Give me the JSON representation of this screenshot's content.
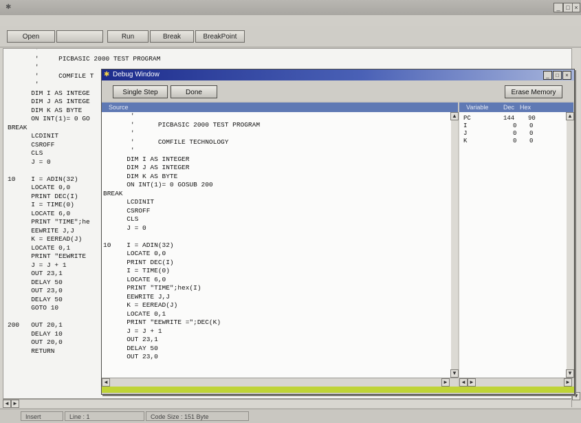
{
  "window": {
    "title": "",
    "minimize": "_",
    "maximize": "□",
    "close": "×"
  },
  "toolbar": {
    "open": "Open",
    "blank": "",
    "run": "Run",
    "break": "Break",
    "breakpoint": "BreakPoint"
  },
  "editor": {
    "code": "       '\n       '     PICBASIC 2000 TEST PROGRAM\n       '\n       '     COMFILE T\n       '\n      DIM I AS INTEGE\n      DIM J AS INTEGE\n      DIM K AS BYTE\n      ON INT(1)= 0 GO\nBREAK\n      LCDINIT\n      CSROFF\n      CLS\n      J = 0\n\n10    I = ADIN(32)\n      LOCATE 0,0\n      PRINT DEC(I)\n      I = TIME(0)\n      LOCATE 6,0\n      PRINT \"TIME\";he\n      EEWRITE J,J\n      K = EEREAD(J)\n      LOCATE 0,1\n      PRINT \"EEWRITE\n      J = J + 1\n      OUT 23,1\n      DELAY 50\n      OUT 23,0\n      DELAY 50\n      GOTO 10\n\n200   OUT 20,1\n      DELAY 10\n      OUT 20,0\n      RETURN"
  },
  "debug": {
    "title": "Debug Window",
    "buttons": {
      "single_step": "Single Step",
      "done": "Done",
      "erase_memory": "Erase Memory"
    },
    "source_header": "Source",
    "source_code": "       '\n       '      PICBASIC 2000 TEST PROGRAM\n       '\n       '      COMFILE TECHNOLOGY\n       '\n      DIM I AS INTEGER\n      DIM J AS INTEGER\n      DIM K AS BYTE\n      ON INT(1)= 0 GOSUB 200\nBREAK\n      LCDINIT\n      CSROFF\n      CLS\n      J = 0\n\n10    I = ADIN(32)\n      LOCATE 0,0\n      PRINT DEC(I)\n      I = TIME(0)\n      LOCATE 6,0\n      PRINT \"TIME\";hex(I)\n      EEWRITE J,J\n      K = EEREAD(J)\n      LOCATE 0,1\n      PRINT \"EEWRITE =\";DEC(K)\n      J = J + 1\n      OUT 23,1\n      DELAY 50\n      OUT 23,0",
    "variables_header": {
      "variable": "Variable",
      "dec": "Dec",
      "hex": "Hex"
    },
    "variables": [
      {
        "name": "PC",
        "dec": "144",
        "hex": "90"
      },
      {
        "name": "I",
        "dec": "0",
        "hex": "0"
      },
      {
        "name": "J",
        "dec": "0",
        "hex": "0"
      },
      {
        "name": "K",
        "dec": "0",
        "hex": "0"
      }
    ]
  },
  "status": {
    "mode": "Insert",
    "line": "Line : 1",
    "code_size": "Code Size : 151 Byte"
  },
  "icons": {
    "arrow_up": "▲",
    "arrow_down": "▼",
    "arrow_left": "◄",
    "arrow_right": "►",
    "app_icon": "✱"
  },
  "colors": {
    "debug_title_start": "#1d2c8c",
    "panel_header": "#5f79b4",
    "debug_bottom_bar": "#bfd436"
  }
}
